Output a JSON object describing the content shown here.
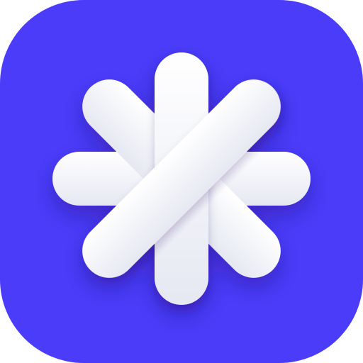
{
  "icon": {
    "name": "asterisk-icon",
    "colors": {
      "background": "#4B3CFA",
      "glyph": "#FFFFFF",
      "glyph_shade": "#E6E8F2",
      "shadow": "#1A1060"
    }
  }
}
